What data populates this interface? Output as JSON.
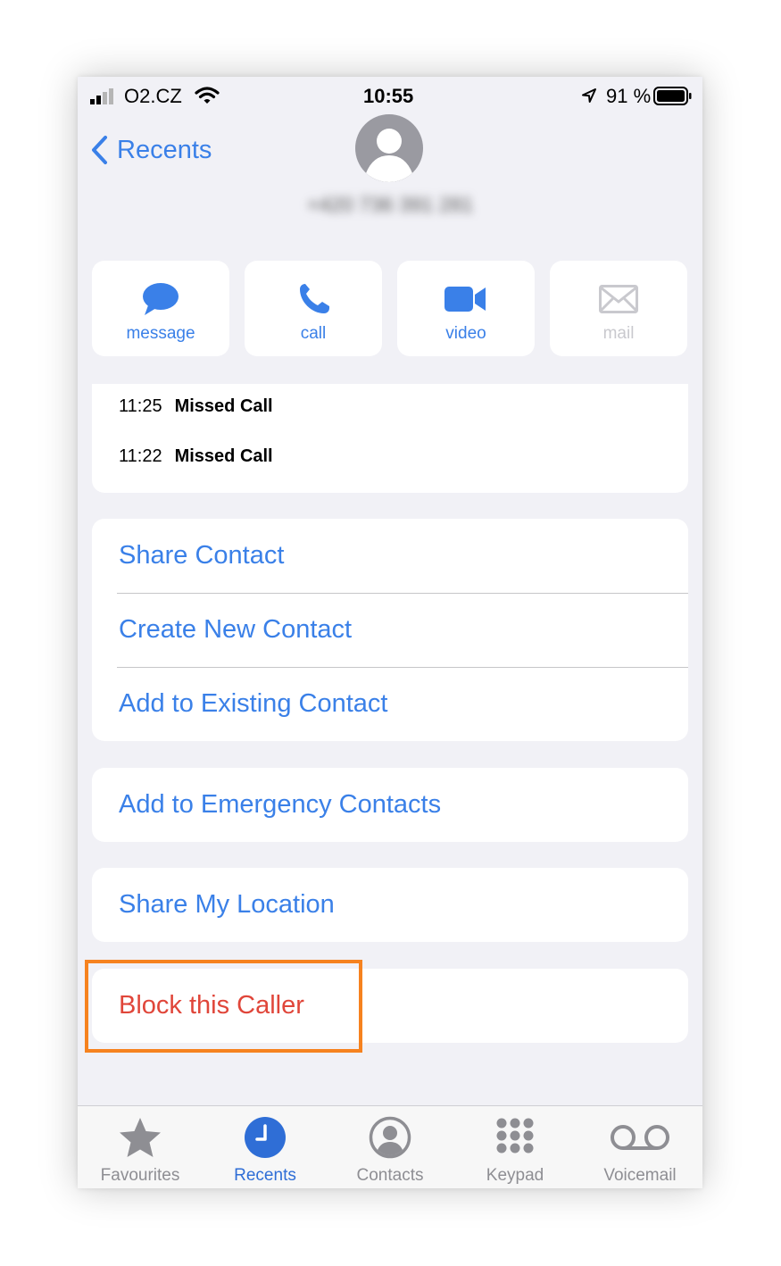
{
  "status_bar": {
    "carrier": "O2.CZ",
    "time": "10:55",
    "battery": "91 %"
  },
  "nav": {
    "back_label": "Recents",
    "phone_number": "+420 736 391 281"
  },
  "actions": [
    {
      "label": "message",
      "icon": "message-bubble-icon",
      "enabled": true
    },
    {
      "label": "call",
      "icon": "phone-icon",
      "enabled": true
    },
    {
      "label": "video",
      "icon": "video-camera-icon",
      "enabled": true
    },
    {
      "label": "mail",
      "icon": "envelope-icon",
      "enabled": false
    }
  ],
  "calls": [
    {
      "time": "11:25",
      "type": "Missed Call"
    },
    {
      "time": "11:22",
      "type": "Missed Call"
    }
  ],
  "options_group1": [
    "Share Contact",
    "Create New Contact",
    "Add to Existing Contact"
  ],
  "emergency": "Add to Emergency Contacts",
  "share_location": "Share My Location",
  "block": "Block this Caller",
  "tabs": [
    {
      "label": "Favourites",
      "icon": "star-icon",
      "active": false
    },
    {
      "label": "Recents",
      "icon": "clock-icon",
      "active": true
    },
    {
      "label": "Contacts",
      "icon": "person-circle-icon",
      "active": false
    },
    {
      "label": "Keypad",
      "icon": "keypad-icon",
      "active": false
    },
    {
      "label": "Voicemail",
      "icon": "voicemail-icon",
      "active": false
    }
  ],
  "colors": {
    "accent": "#3a80e8",
    "destructive": "#e0463a",
    "highlight": "#f6821f",
    "background": "#f1f1f6"
  }
}
